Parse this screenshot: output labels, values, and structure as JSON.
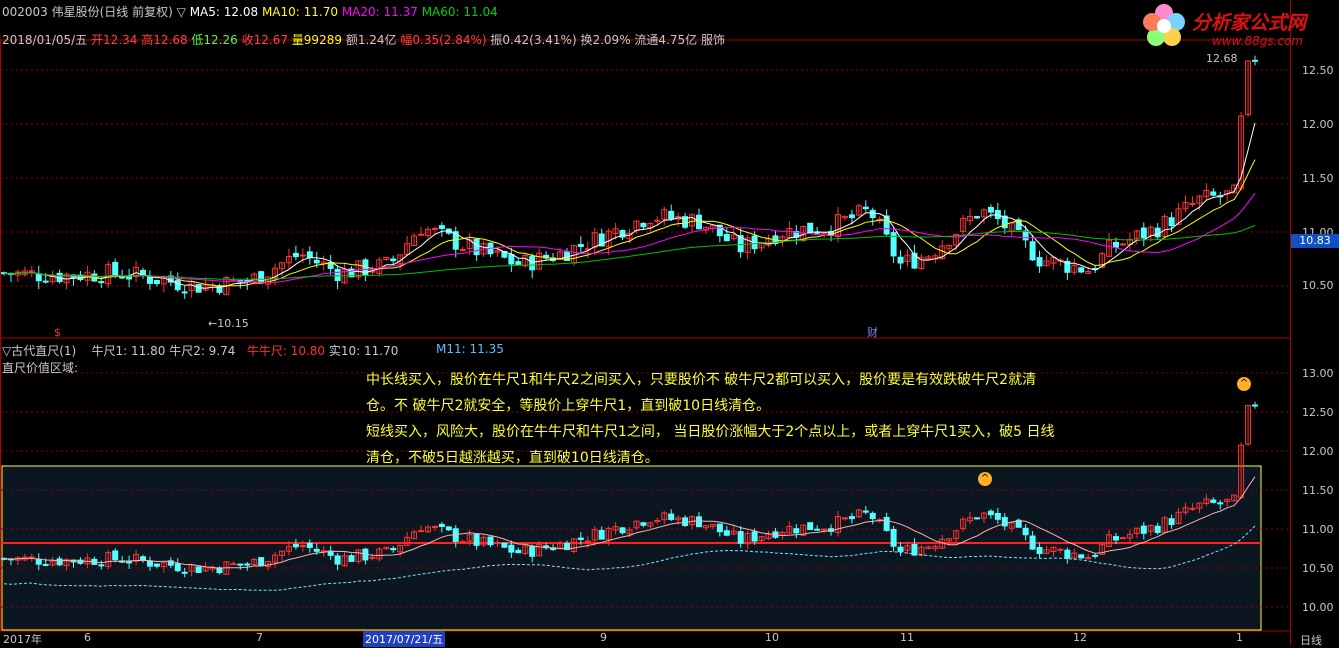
{
  "header": {
    "code_name": "002003 伟星股份(日线 前复权)",
    "ma_marker": "▽",
    "ma5": "MA5: 12.08",
    "ma10": "MA10: 11.70",
    "ma20": "MA20: 11.37",
    "ma60": "MA60: 11.04"
  },
  "quote": {
    "date": "2018/01/05/五",
    "open": "开12.34",
    "high": "高12.68",
    "low": "低12.26",
    "close": "收12.67",
    "volume": "量99289",
    "amount": "额1.24亿",
    "change": "幅0.35(2.84%)",
    "amplitude": "振0.42(3.41%)",
    "turnover": "换2.09%",
    "float": "流通4.75亿",
    "industry": "服饰"
  },
  "logo": {
    "title": "分析家公式网",
    "url": "www.88gs.com"
  },
  "main_axis": {
    "ticks": [
      "12.50",
      "12.00",
      "11.50",
      "11.00",
      "10.50"
    ],
    "current_price": "10.83",
    "high_marker": "12.68",
    "low_marker": "10.15",
    "low_arrow": "←",
    "event_marker": "财",
    "dividend_marker": "$"
  },
  "indicator": {
    "name": "▽古代直尺(1)",
    "ruler1": "牛尺1: 11.80",
    "ruler2": "牛尺2: 9.74",
    "bull_ruler": "牛牛尺: 10.80",
    "real10": "实10: 11.70",
    "m11": "M11: 11.35",
    "zone_label": "直尺价值区域:",
    "ticks": [
      "13.00",
      "12.50",
      "12.00",
      "11.50",
      "11.00",
      "10.50",
      "10.00"
    ]
  },
  "annotation": {
    "line1": "中长线买入，股价在牛尺1和牛尺2之间买入，只要股价不 破牛尺2都可以买入，股价要是有效跌破牛尺2就清",
    "line2": "仓。不 破牛尺2就安全，等股价上穿牛尺1，直到破10日线清仓。",
    "line3": "短线买入，风险大，股价在牛牛尺和牛尺1之间， 当日股价涨幅大于2个点以上，或者上穿牛尺1买入，破5 日线",
    "line4": "清仓，不破5日越涨越买，直到破10日线清仓。"
  },
  "time_axis": {
    "labels": [
      "2017年",
      "6",
      "7",
      "2017/07/21/五",
      "9",
      "10",
      "11",
      "12",
      "1"
    ],
    "period": "日线"
  },
  "colors": {
    "up": "#ff3232",
    "down": "#54ffff",
    "ma5": "#ffffff",
    "ma10": "#ffff00",
    "ma20": "#ff00ff",
    "ma60": "#00c000",
    "grid": "#8b0000",
    "frame": "#b00000",
    "annotation": "#ffff33",
    "zone_bg": "#0b1621"
  }
}
